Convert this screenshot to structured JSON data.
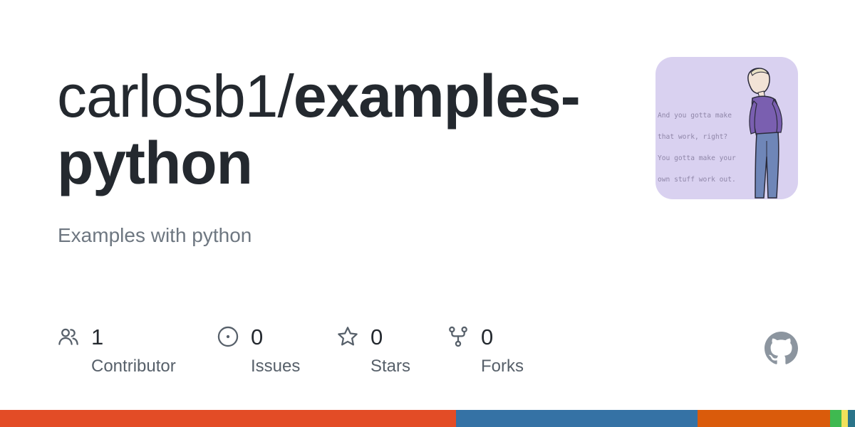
{
  "repo": {
    "owner_prefix": "carlosb1/",
    "name_line1": "examples-",
    "name_line2": "python",
    "description": "Examples with python"
  },
  "avatar": {
    "quote_lines": [
      "And you gotta make",
      "that work, right?",
      "You gotta make your",
      "own stuff work out."
    ],
    "background": "#d9d1f0"
  },
  "stats": {
    "contributors": {
      "value": "1",
      "label": "Contributor",
      "icon": "people-icon"
    },
    "issues": {
      "value": "0",
      "label": "Issues",
      "icon": "issue-opened-icon"
    },
    "stars": {
      "value": "0",
      "label": "Stars",
      "icon": "star-icon"
    },
    "forks": {
      "value": "0",
      "label": "Forks",
      "icon": "repo-forked-icon"
    }
  },
  "logo": {
    "icon": "github-mark-icon",
    "color": "#8c959f"
  },
  "language_bar": [
    {
      "color": "#e34c26",
      "share": 0.533
    },
    {
      "color": "#3572a5",
      "share": 0.283
    },
    {
      "color": "#da5b0b",
      "share": 0.155
    },
    {
      "color": "#3fb950",
      "share": 0.013
    },
    {
      "color": "#f1e05a",
      "share": 0.008
    },
    {
      "color": "#2b7489",
      "share": 0.008
    }
  ]
}
